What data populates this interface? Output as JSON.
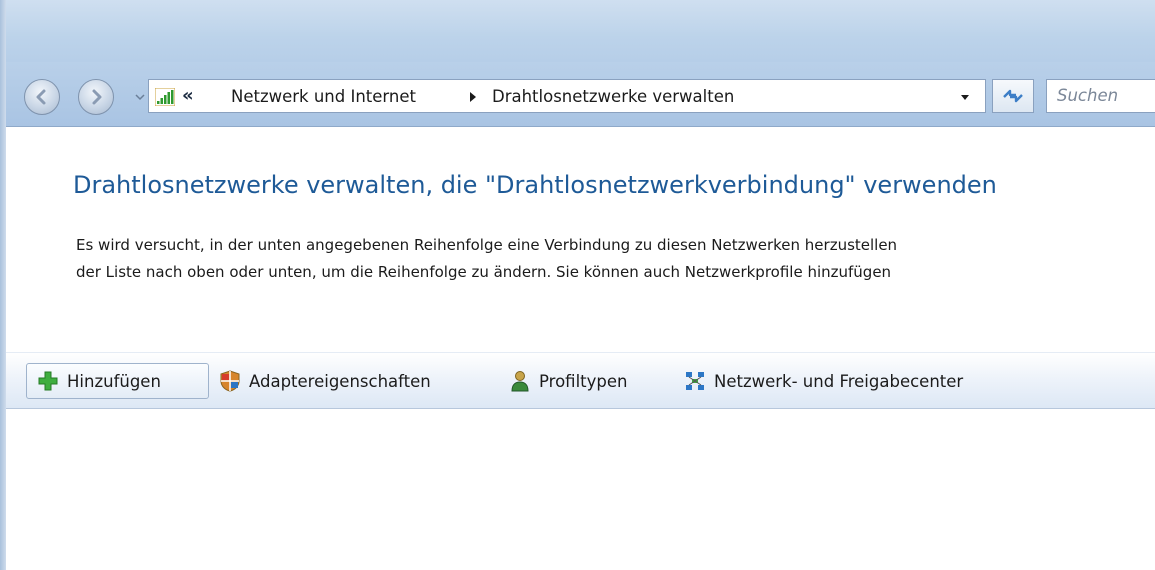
{
  "navigation": {
    "back_label": "Zurück",
    "forward_label": "Vorwärts"
  },
  "address_bar": {
    "overflow_glyph": "«",
    "breadcrumbs": [
      "Netzwerk und Internet",
      "Drahtlosnetzwerke verwalten"
    ]
  },
  "search": {
    "placeholder": "Suchen"
  },
  "main": {
    "heading": "Drahtlosnetzwerke verwalten, die \"Drahtlosnetzwerkverbindung\" verwenden",
    "description_lines": [
      "Es wird versucht, in der unten angegebenen Reihenfolge eine Verbindung zu diesen Netzwerken herzustellen",
      "der Liste nach oben oder unten, um die Reihenfolge zu ändern. Sie können auch Netzwerkprofile hinzufügen"
    ]
  },
  "toolbar": {
    "items": [
      {
        "label": "Hinzufügen",
        "icon": "add-icon"
      },
      {
        "label": "Adaptereigenschaften",
        "icon": "shield-icon"
      },
      {
        "label": "Profiltypen",
        "icon": "user-icon"
      },
      {
        "label": "Netzwerk- und Freigabecenter",
        "icon": "network-icon"
      }
    ]
  },
  "colors": {
    "heading": "#1e5a97",
    "chrome": "#b9d0e9"
  }
}
